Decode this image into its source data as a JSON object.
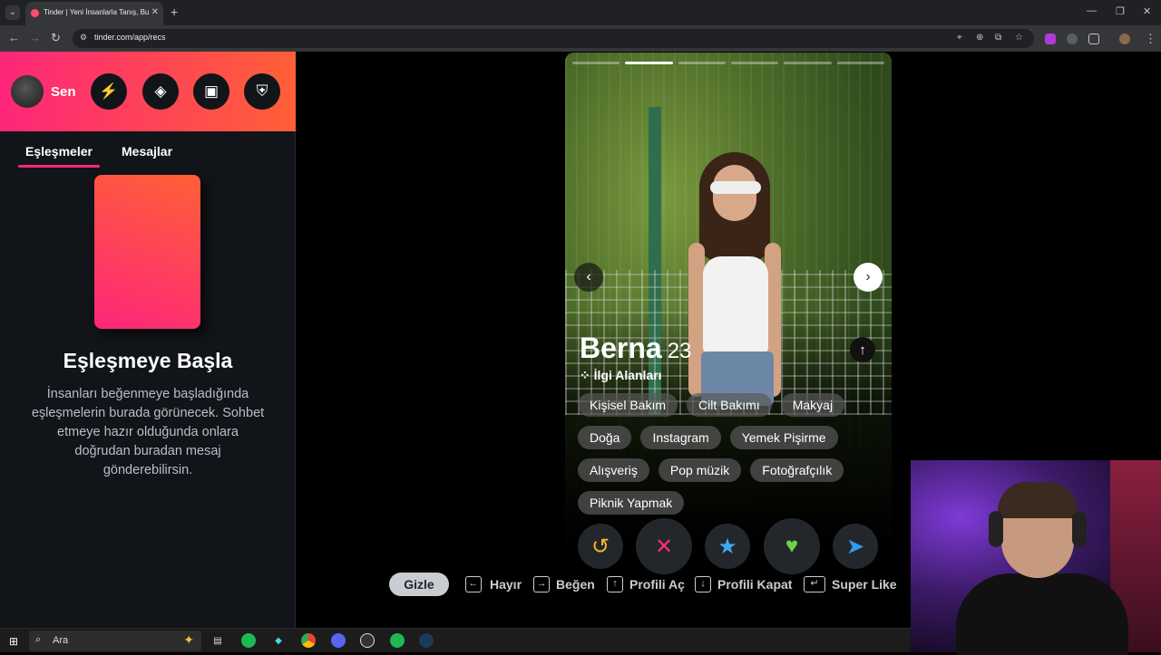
{
  "browser": {
    "tab_title": "Tinder | Yeni İnsanlarla Tanış, Bu",
    "url": "tinder.com/app/recs"
  },
  "sidebar": {
    "user_label": "Sen",
    "tabs": [
      "Eşleşmeler",
      "Mesajlar"
    ],
    "empty_title": "Eşleşmeye Başla",
    "empty_desc": "İnsanları beğenmeye başladığında eşleşmelerin burada görünecek. Sohbet etmeye hazır olduğunda onlara doğrudan buradan mesaj gönderebilirsin."
  },
  "profile": {
    "name": "Berna",
    "age": "23",
    "interests_heading": "İlgi Alanları",
    "interests": [
      "Kişisel Bakım",
      "Cilt Bakımı",
      "Makyaj",
      "Doğa",
      "Instagram",
      "Yemek Pişirme",
      "Alışveriş",
      "Pop müzik",
      "Fotoğrafçılık",
      "Piknik Yapmak"
    ],
    "photo_count": 6,
    "active_photo": 2
  },
  "shortcuts": {
    "hide_label": "Gizle",
    "items": [
      {
        "key": "←",
        "label": "Hayır"
      },
      {
        "key": "→",
        "label": "Beğen"
      },
      {
        "key": "↑",
        "label": "Profili Aç"
      },
      {
        "key": "↓",
        "label": "Profili Kapat"
      },
      {
        "key": "↵",
        "label": "Super Like"
      }
    ]
  },
  "taskbar": {
    "search_placeholder": "Ara"
  },
  "colors": {
    "brand_start": "#fd267a",
    "brand_end": "#ff6036",
    "like": "#6ad34a",
    "nope": "#fd2d6b",
    "superlike": "#3ea7f5",
    "rewind": "#f6b52a",
    "boost": "#2f9df4"
  }
}
